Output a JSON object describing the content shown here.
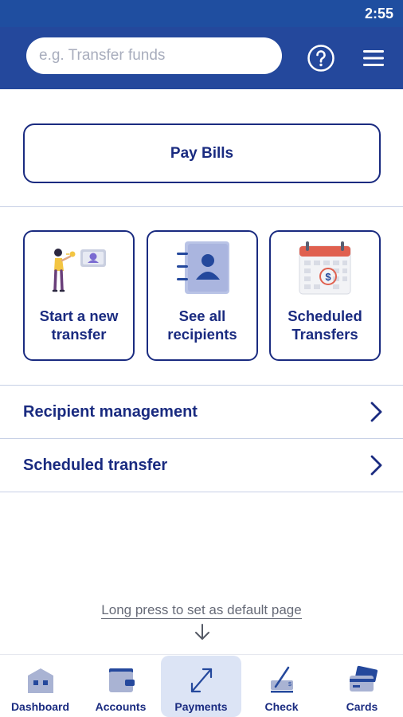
{
  "status_bar": {
    "time": "2:55"
  },
  "header": {
    "search_placeholder": "e.g. Transfer funds",
    "help_icon": "question-circle-icon",
    "menu_icon": "hamburger-menu-icon"
  },
  "pay_bills": {
    "label": "Pay Bills"
  },
  "tiles": [
    {
      "line1": "Start a new",
      "line2": "transfer",
      "icon": "person-phone-transfer-illustration"
    },
    {
      "line1": "See all",
      "line2": "recipients",
      "icon": "address-book-illustration"
    },
    {
      "line1": "Scheduled",
      "line2": "Transfers",
      "icon": "calendar-dollar-illustration"
    }
  ],
  "rows": [
    {
      "label": "Recipient management",
      "icon": "chevron-right-icon"
    },
    {
      "label": "Scheduled transfer",
      "icon": "chevron-right-icon"
    }
  ],
  "hint": {
    "text": "Long press to set as default page"
  },
  "tabbar": {
    "active": "Payments",
    "tabs": [
      {
        "label": "Dashboard",
        "icon": "bank-building-icon"
      },
      {
        "label": "Accounts",
        "icon": "wallet-icon"
      },
      {
        "label": "Payments",
        "icon": "transfer-arrows-icon"
      },
      {
        "label": "Check",
        "icon": "check-deposit-icon"
      },
      {
        "label": "Cards",
        "icon": "credit-cards-icon"
      }
    ]
  },
  "colors": {
    "primary": "#1a2b80",
    "header_bg": "#24489c",
    "status_bg": "#1f4ea0",
    "active_tab_bg": "#dce4f5"
  }
}
